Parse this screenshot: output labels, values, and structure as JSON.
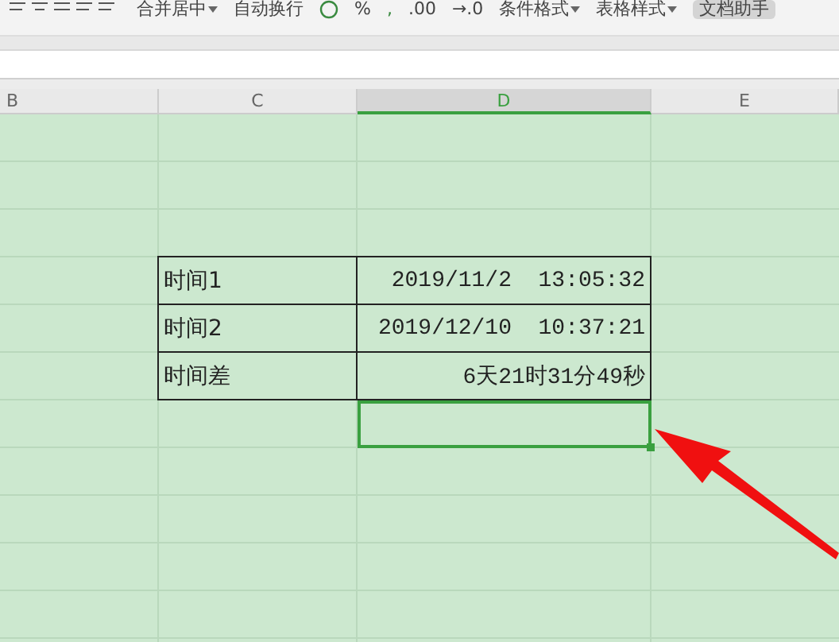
{
  "toolbar": {
    "merge": "合并居中",
    "wrap": "自动换行",
    "percent": "%",
    "comma": ",",
    "decimal_add": ".00",
    "decimal_remove": "→.0",
    "conditional": "条件格式",
    "table_style": "表格样式",
    "assistant": "文档助手"
  },
  "columns": [
    {
      "label": "B",
      "selected": false
    },
    {
      "label": "C",
      "selected": false
    },
    {
      "label": "D",
      "selected": true
    },
    {
      "label": "E",
      "selected": false
    }
  ],
  "table": [
    {
      "label": "时间1",
      "value": "2019/11/2  13:05:32"
    },
    {
      "label": "时间2",
      "value": "2019/12/10  10:37:21"
    },
    {
      "label": "时间差",
      "value": "6天21时31分49秒"
    }
  ]
}
